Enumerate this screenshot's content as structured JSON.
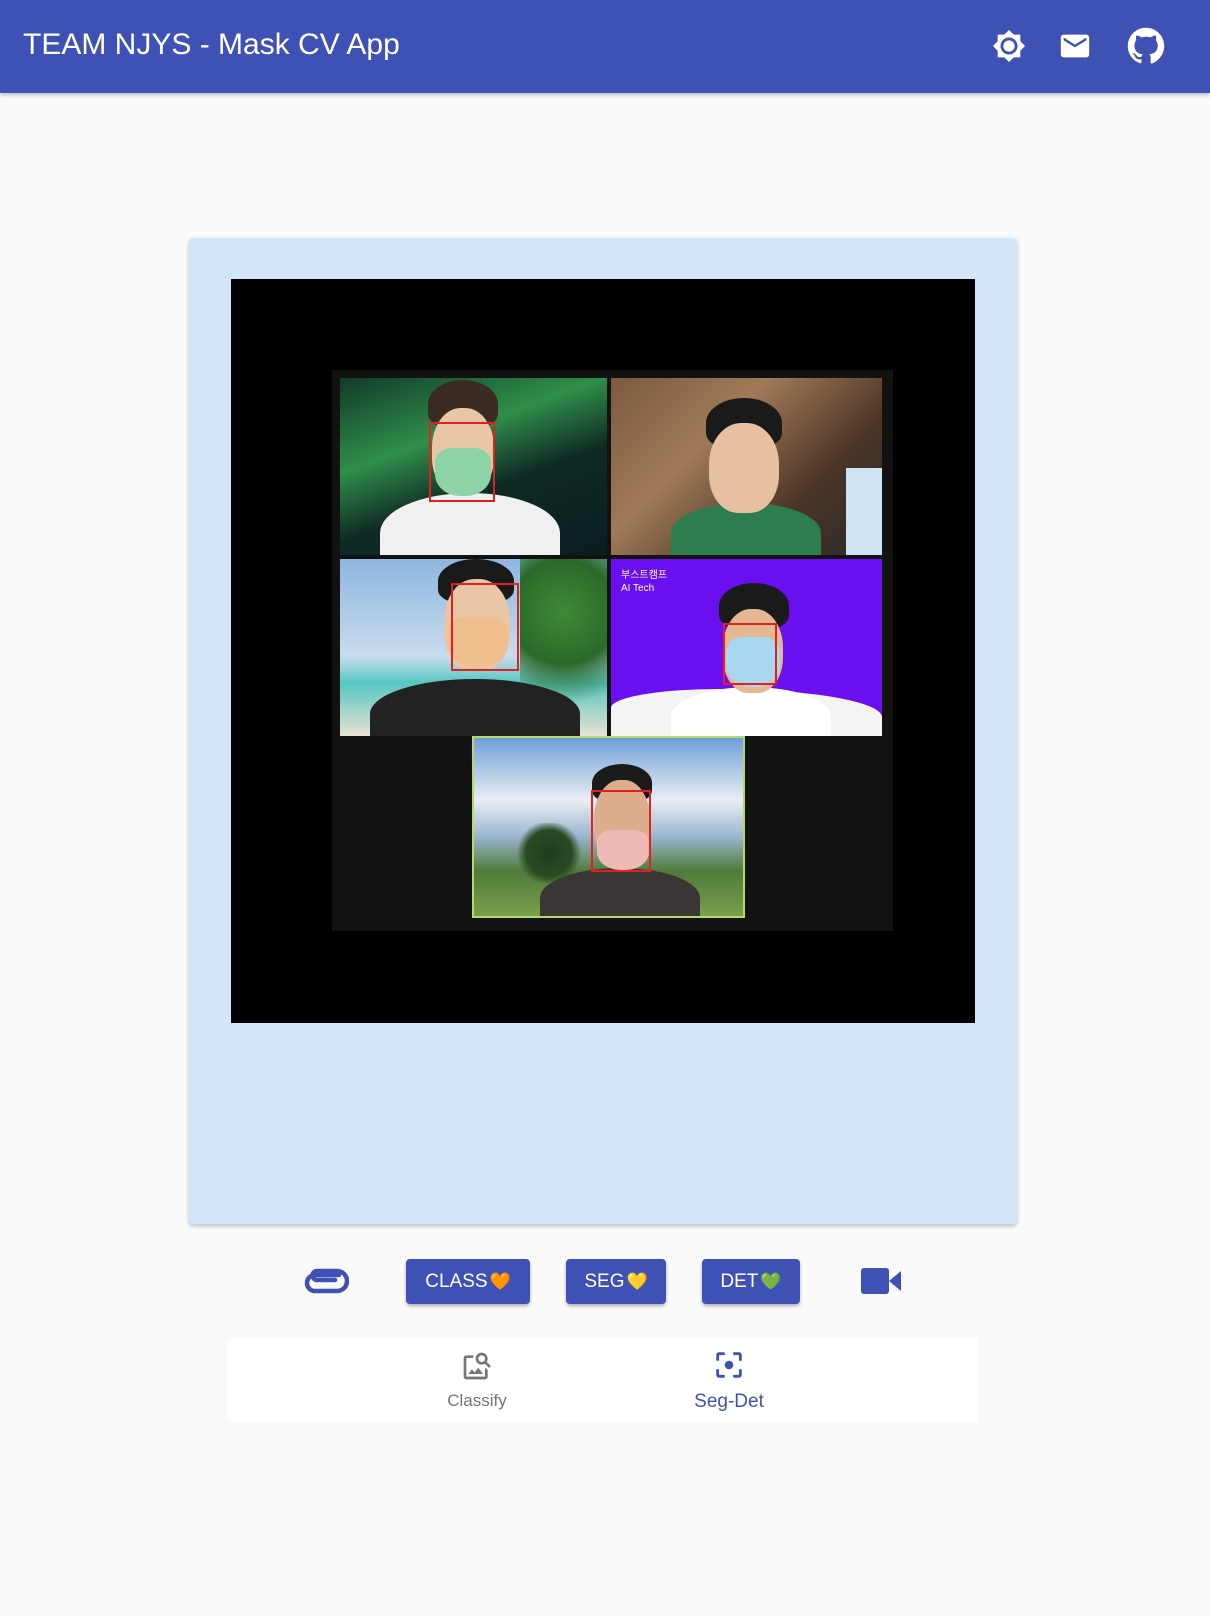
{
  "app": {
    "title": "TEAM NJYS - Mask CV App",
    "brand_color": "#3f51b5"
  },
  "appbar_actions": [
    {
      "icon": "brightness-icon"
    },
    {
      "icon": "mail-icon"
    },
    {
      "icon": "github-icon"
    }
  ],
  "result_image": {
    "overlay_text_line1": "부스트캠프",
    "overlay_text_line2": "AI Tech",
    "detection_box_color": "#e32020"
  },
  "toolbar": {
    "attach_icon": "paperclip-icon",
    "class_label": "CLASS",
    "class_heart": "🧡",
    "seg_label": "SEG",
    "seg_heart": "💛",
    "det_label": "DET",
    "det_heart": "💚",
    "video_icon": "videocam-icon"
  },
  "bottom_nav": {
    "items": [
      {
        "label": "Classify",
        "icon": "image-search-icon",
        "active": false
      },
      {
        "label": "Seg-Det",
        "icon": "center-focus-icon",
        "active": true
      }
    ]
  }
}
